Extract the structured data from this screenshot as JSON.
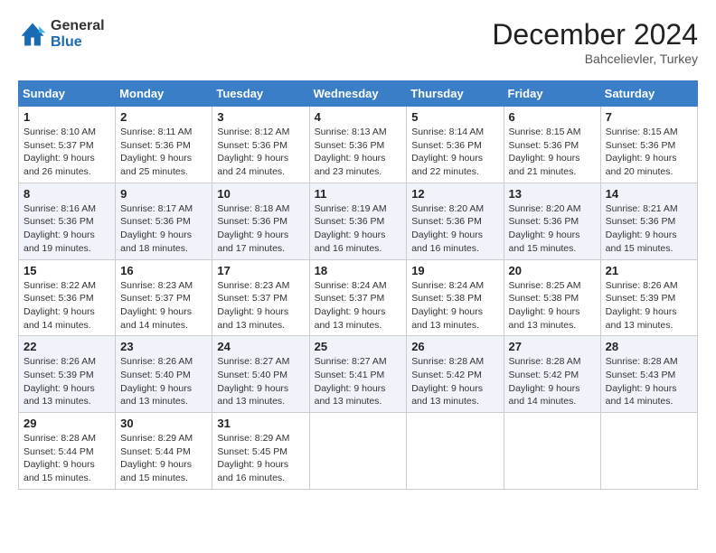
{
  "header": {
    "logo_general": "General",
    "logo_blue": "Blue",
    "month_year": "December 2024",
    "location": "Bahcelievler, Turkey"
  },
  "weekdays": [
    "Sunday",
    "Monday",
    "Tuesday",
    "Wednesday",
    "Thursday",
    "Friday",
    "Saturday"
  ],
  "weeks": [
    [
      {
        "day": "1",
        "sunrise": "8:10 AM",
        "sunset": "5:37 PM",
        "daylight": "9 hours and 26 minutes."
      },
      {
        "day": "2",
        "sunrise": "8:11 AM",
        "sunset": "5:36 PM",
        "daylight": "9 hours and 25 minutes."
      },
      {
        "day": "3",
        "sunrise": "8:12 AM",
        "sunset": "5:36 PM",
        "daylight": "9 hours and 24 minutes."
      },
      {
        "day": "4",
        "sunrise": "8:13 AM",
        "sunset": "5:36 PM",
        "daylight": "9 hours and 23 minutes."
      },
      {
        "day": "5",
        "sunrise": "8:14 AM",
        "sunset": "5:36 PM",
        "daylight": "9 hours and 22 minutes."
      },
      {
        "day": "6",
        "sunrise": "8:15 AM",
        "sunset": "5:36 PM",
        "daylight": "9 hours and 21 minutes."
      },
      {
        "day": "7",
        "sunrise": "8:15 AM",
        "sunset": "5:36 PM",
        "daylight": "9 hours and 20 minutes."
      }
    ],
    [
      {
        "day": "8",
        "sunrise": "8:16 AM",
        "sunset": "5:36 PM",
        "daylight": "9 hours and 19 minutes."
      },
      {
        "day": "9",
        "sunrise": "8:17 AM",
        "sunset": "5:36 PM",
        "daylight": "9 hours and 18 minutes."
      },
      {
        "day": "10",
        "sunrise": "8:18 AM",
        "sunset": "5:36 PM",
        "daylight": "9 hours and 17 minutes."
      },
      {
        "day": "11",
        "sunrise": "8:19 AM",
        "sunset": "5:36 PM",
        "daylight": "9 hours and 16 minutes."
      },
      {
        "day": "12",
        "sunrise": "8:20 AM",
        "sunset": "5:36 PM",
        "daylight": "9 hours and 16 minutes."
      },
      {
        "day": "13",
        "sunrise": "8:20 AM",
        "sunset": "5:36 PM",
        "daylight": "9 hours and 15 minutes."
      },
      {
        "day": "14",
        "sunrise": "8:21 AM",
        "sunset": "5:36 PM",
        "daylight": "9 hours and 15 minutes."
      }
    ],
    [
      {
        "day": "15",
        "sunrise": "8:22 AM",
        "sunset": "5:36 PM",
        "daylight": "9 hours and 14 minutes."
      },
      {
        "day": "16",
        "sunrise": "8:23 AM",
        "sunset": "5:37 PM",
        "daylight": "9 hours and 14 minutes."
      },
      {
        "day": "17",
        "sunrise": "8:23 AM",
        "sunset": "5:37 PM",
        "daylight": "9 hours and 13 minutes."
      },
      {
        "day": "18",
        "sunrise": "8:24 AM",
        "sunset": "5:37 PM",
        "daylight": "9 hours and 13 minutes."
      },
      {
        "day": "19",
        "sunrise": "8:24 AM",
        "sunset": "5:38 PM",
        "daylight": "9 hours and 13 minutes."
      },
      {
        "day": "20",
        "sunrise": "8:25 AM",
        "sunset": "5:38 PM",
        "daylight": "9 hours and 13 minutes."
      },
      {
        "day": "21",
        "sunrise": "8:26 AM",
        "sunset": "5:39 PM",
        "daylight": "9 hours and 13 minutes."
      }
    ],
    [
      {
        "day": "22",
        "sunrise": "8:26 AM",
        "sunset": "5:39 PM",
        "daylight": "9 hours and 13 minutes."
      },
      {
        "day": "23",
        "sunrise": "8:26 AM",
        "sunset": "5:40 PM",
        "daylight": "9 hours and 13 minutes."
      },
      {
        "day": "24",
        "sunrise": "8:27 AM",
        "sunset": "5:40 PM",
        "daylight": "9 hours and 13 minutes."
      },
      {
        "day": "25",
        "sunrise": "8:27 AM",
        "sunset": "5:41 PM",
        "daylight": "9 hours and 13 minutes."
      },
      {
        "day": "26",
        "sunrise": "8:28 AM",
        "sunset": "5:42 PM",
        "daylight": "9 hours and 13 minutes."
      },
      {
        "day": "27",
        "sunrise": "8:28 AM",
        "sunset": "5:42 PM",
        "daylight": "9 hours and 14 minutes."
      },
      {
        "day": "28",
        "sunrise": "8:28 AM",
        "sunset": "5:43 PM",
        "daylight": "9 hours and 14 minutes."
      }
    ],
    [
      {
        "day": "29",
        "sunrise": "8:28 AM",
        "sunset": "5:44 PM",
        "daylight": "9 hours and 15 minutes."
      },
      {
        "day": "30",
        "sunrise": "8:29 AM",
        "sunset": "5:44 PM",
        "daylight": "9 hours and 15 minutes."
      },
      {
        "day": "31",
        "sunrise": "8:29 AM",
        "sunset": "5:45 PM",
        "daylight": "9 hours and 16 minutes."
      },
      null,
      null,
      null,
      null
    ]
  ],
  "labels": {
    "sunrise": "Sunrise:",
    "sunset": "Sunset:",
    "daylight": "Daylight:"
  }
}
